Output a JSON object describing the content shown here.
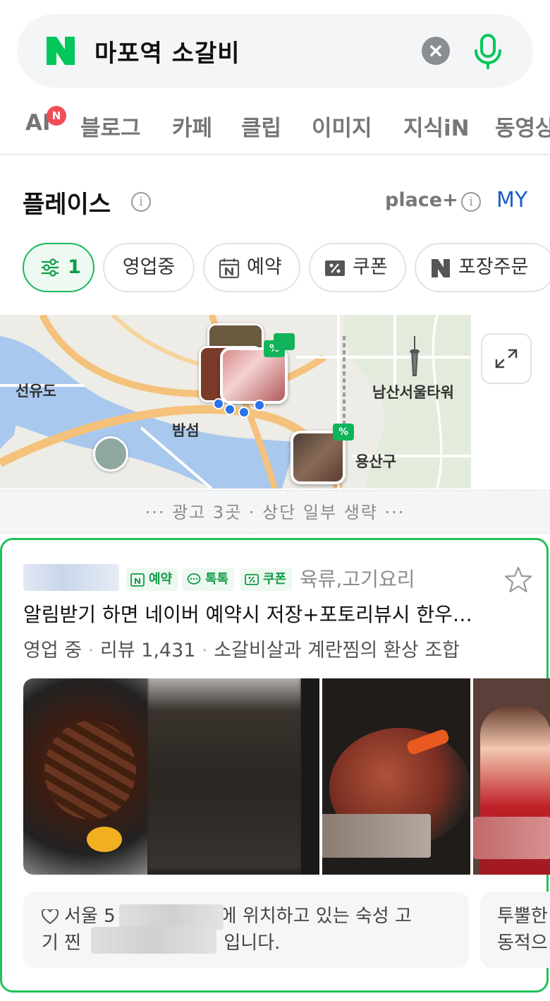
{
  "search": {
    "query": "마포역 소갈비"
  },
  "tabs": [
    {
      "label": "AI",
      "badge": "N"
    },
    {
      "label": "블로그"
    },
    {
      "label": "카페"
    },
    {
      "label": "클립"
    },
    {
      "label": "이미지"
    },
    {
      "label": "지식iN"
    },
    {
      "label": "동영상"
    }
  ],
  "place": {
    "title": "플레이스",
    "plus_label": "place+",
    "my_label": "MY",
    "filters": [
      {
        "label": "1",
        "active": true,
        "icon": "sliders-icon"
      },
      {
        "label": "영업중"
      },
      {
        "label": "예약",
        "icon": "naver-calendar-icon"
      },
      {
        "label": "쿠폰",
        "icon": "percent-coupon-icon"
      },
      {
        "label": "포장주문",
        "icon": "naver-n-icon"
      }
    ]
  },
  "map": {
    "labels": [
      "선유도",
      "밤섬",
      "남산서울타워",
      "용산구"
    ]
  },
  "ad_notice": "··· 광고 3곳 · 상단 일부 생략 ···",
  "card": {
    "badges": [
      "예약",
      "톡톡",
      "쿠폰"
    ],
    "category": "육류,고기요리",
    "headline": "알림받기 하면 네이버 예약시 저장+포토리뷰시 한우…",
    "status": "영업 중",
    "review_label": "리뷰 1,431",
    "tagline": "소갈비살과 계란찜의 환상 조합",
    "description_line1_start": "서울 5",
    "description_line1_end": "에 위치하고 있는 숙성 고",
    "description_line2_start": "기 찐 ",
    "description_line2_end": "입니다.",
    "description2_line1": "투뿔한",
    "description2_line2": "동적으"
  },
  "colors": {
    "naver_green": "#03c75a",
    "accent_blue": "#1a5fc8",
    "badge_green": "#119b47"
  }
}
